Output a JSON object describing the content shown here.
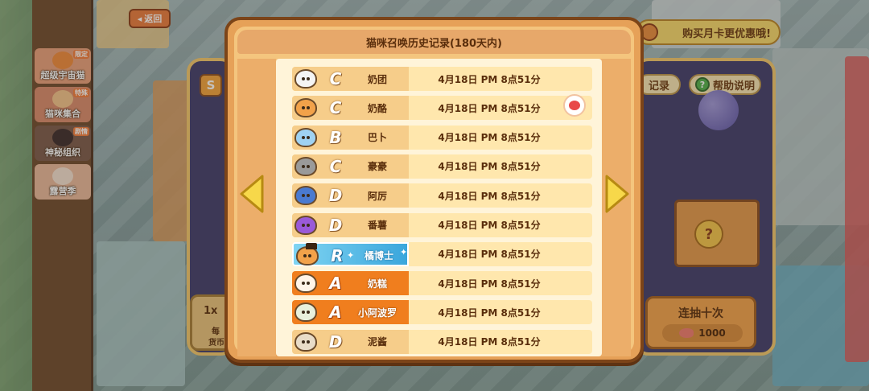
{
  "nav": {
    "back_label": "返回",
    "side_items": [
      {
        "label": "超级宇宙猫",
        "tag": "限定"
      },
      {
        "label": "猫咪集合",
        "tag": "特殊"
      },
      {
        "label": "神秘组织",
        "tag": "剧情"
      },
      {
        "label": "露营季",
        "tag": ""
      }
    ]
  },
  "promo": {
    "month_card_label": "购买月卡更优惠哦!"
  },
  "summon_screen": {
    "record_label": "记录",
    "help_label": "帮助说明",
    "help_icon": "?",
    "ten_pull_label": "连抽十次",
    "ten_pull_cost": "1000",
    "single_pull_count": "1x",
    "single_pull_line1": "每",
    "single_pull_line2": "货币",
    "badge": "S",
    "box_icon": "?"
  },
  "history": {
    "title": "猫咪召唤历史记录(180天内)",
    "records": [
      {
        "rarity": "C",
        "name": "奶团",
        "time": "4月18日 PM 8点51分",
        "color": "#f4f4f4"
      },
      {
        "rarity": "C",
        "name": "奶酪",
        "time": "4月18日 PM 8点51分",
        "color": "#f2a24a"
      },
      {
        "rarity": "B",
        "name": "巴卜",
        "time": "4月18日 PM 8点51分",
        "color": "#9fd2f2"
      },
      {
        "rarity": "C",
        "name": "豪豪",
        "time": "4月18日 PM 8点51分",
        "color": "#9a9a9a"
      },
      {
        "rarity": "D",
        "name": "阿厉",
        "time": "4月18日 PM 8点51分",
        "color": "#4a7ad0"
      },
      {
        "rarity": "D",
        "name": "番薯",
        "time": "4月18日 PM 8点51分",
        "color": "#9a5ad8"
      },
      {
        "rarity": "R",
        "name": "橘博士",
        "time": "4月18日 PM 8点51分",
        "color": "#f2a24a"
      },
      {
        "rarity": "A",
        "name": "奶糕",
        "time": "4月18日 PM 8点51分",
        "color": "#fff4e8"
      },
      {
        "rarity": "A",
        "name": "小阿波罗",
        "time": "4月18日 PM 8点51分",
        "color": "#e8f0dc"
      },
      {
        "rarity": "D",
        "name": "泥酱",
        "time": "4月18日 PM 8点51分",
        "color": "#e8dcc8"
      }
    ]
  },
  "colors": {
    "modal_border": "#7c4418",
    "modal_bg": "#f4c57e",
    "row_bg": "#ffe7ad",
    "rare_A": "#f07e1e",
    "rare_R": "#3aa6dc",
    "arrow": "#f7d84a"
  }
}
